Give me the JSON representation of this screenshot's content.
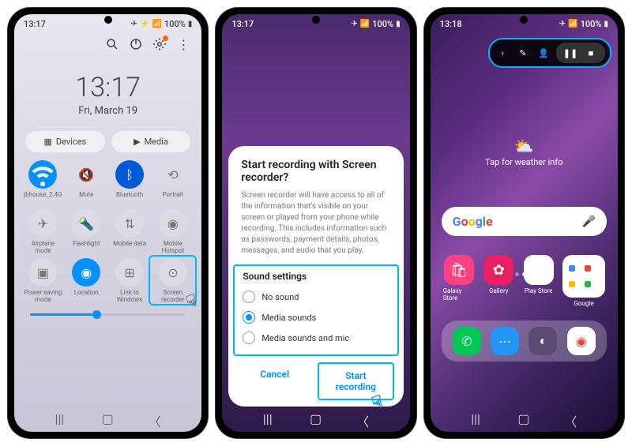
{
  "status": {
    "time1": "13:17",
    "time2": "13:17",
    "time3": "13:18",
    "battery": "100%",
    "icons": "✈ ⚡ ❌ 📶 ⊙"
  },
  "p1": {
    "clock_time": "13:17",
    "clock_date": "Fri, March 19",
    "pills": {
      "devices": "Devices",
      "media": "Media"
    },
    "tiles": [
      {
        "label": "jbhouse_2.4G",
        "state": "on"
      },
      {
        "label": "Mute",
        "state": "off"
      },
      {
        "label": "Bluetooth",
        "state": "on2"
      },
      {
        "label": "Portrait",
        "state": "off"
      },
      {
        "label": "Airplane mode",
        "state": "off"
      },
      {
        "label": "Flashlight",
        "state": "off"
      },
      {
        "label": "Mobile data",
        "state": "off"
      },
      {
        "label": "Mobile Hotspot",
        "state": "off"
      },
      {
        "label": "Power saving mode",
        "state": "off"
      },
      {
        "label": "Location",
        "state": "on"
      },
      {
        "label": "Link to Windows",
        "state": "off"
      },
      {
        "label": "Screen recorder",
        "state": "off"
      }
    ]
  },
  "p2": {
    "title": "Start recording with Screen recorder?",
    "body": "Screen recorder will have access to all of the information that's visible on your screen or played from your phone while recording. This includes information such as passwords, payment details, photos, messages, and audio that you play.",
    "section": "Sound settings",
    "options": [
      "No sound",
      "Media sounds",
      "Media sounds and mic"
    ],
    "selected": 1,
    "cancel": "Cancel",
    "start": "Start recording"
  },
  "p3": {
    "weather": "Tap for weather info",
    "apps": [
      {
        "label": "Galaxy Store",
        "bg": "#ff4081"
      },
      {
        "label": "Gallery",
        "bg": "#e91e63"
      },
      {
        "label": "Play Store",
        "bg": "#fff"
      },
      {
        "label": "Google",
        "bg": "#fff"
      }
    ],
    "dock": [
      {
        "bg": "#00c853",
        "glyph": "✆"
      },
      {
        "bg": "#2196f3",
        "glyph": "⋯"
      },
      {
        "bg": "#5b4a72",
        "glyph": "◐"
      },
      {
        "bg": "#fff",
        "glyph": "◉"
      }
    ]
  }
}
